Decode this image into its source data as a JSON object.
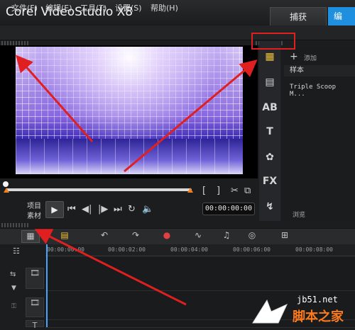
{
  "app": {
    "title": "Corel VideoStudio X8"
  },
  "tabs": [
    {
      "label": "捕获"
    },
    {
      "label": "编"
    }
  ],
  "menu": [
    {
      "label": "文件(F)"
    },
    {
      "label": "编辑(E)"
    },
    {
      "label": "工具(T)"
    },
    {
      "label": "设置(S)"
    },
    {
      "label": "帮助(H)"
    }
  ],
  "preview": {
    "labels": {
      "project": "项目",
      "clip": "素材"
    },
    "timecode": "00:00:00:00",
    "bracket_in": "[",
    "bracket_out": "]"
  },
  "library": {
    "add_label": "添加",
    "category": "样本",
    "item": "Triple Scoop M...",
    "browse_label": "浏览"
  },
  "timeline": {
    "ruler": [
      "00:00:00:00",
      "00:00:02:00",
      "00:00:04:00",
      "00:00:06:00",
      "00:00:08:00"
    ]
  },
  "watermark": {
    "site": "jb51.net",
    "name": "脚本之家"
  },
  "colors": {
    "accent": "#1f8fe0",
    "annotation": "#e02020",
    "marker": "#f08020",
    "watermark": "#ff7a1a"
  },
  "icons": [
    "film-icon",
    "title-icon",
    "transition-icon",
    "fx-icon",
    "path-icon",
    "undo-icon",
    "redo-icon",
    "record-icon",
    "audio-icon",
    "add-icon"
  ]
}
